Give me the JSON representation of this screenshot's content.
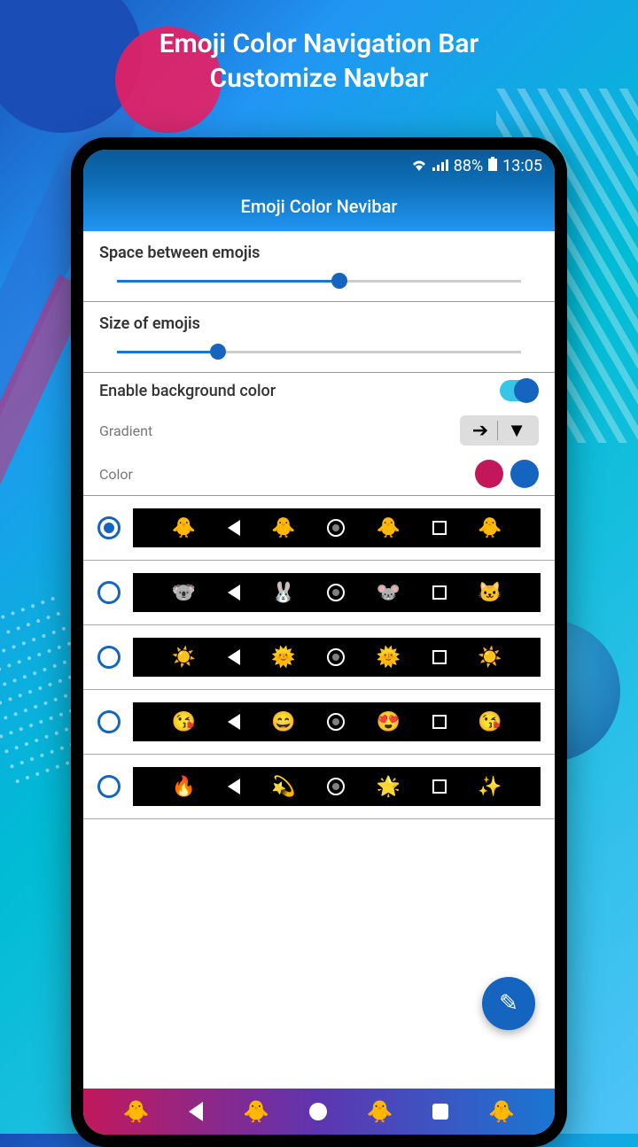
{
  "promo": {
    "line1": "Emoji Color Navigation Bar",
    "line2": "Customize Navbar"
  },
  "statusbar": {
    "battery": "88%",
    "time": "13:05"
  },
  "header": {
    "title": "Emoji Color Nevibar"
  },
  "settings": {
    "space_label": "Space between emojis",
    "space_value": 55,
    "size_label": "Size of emojis",
    "size_value": 25,
    "enable_bg_label": "Enable background color",
    "enable_bg": true,
    "gradient_label": "Gradient",
    "color_label": "Color",
    "colors": {
      "primary": "#c2185b",
      "secondary": "#1565C0"
    }
  },
  "presets": [
    {
      "selected": true,
      "emojis": [
        "🐥",
        "🐥",
        "🐥",
        "🐥"
      ]
    },
    {
      "selected": false,
      "emojis": [
        "🐨",
        "🐰",
        "🐭",
        "🐱"
      ]
    },
    {
      "selected": false,
      "emojis": [
        "☀️",
        "🌞",
        "🌞",
        "☀️"
      ]
    },
    {
      "selected": false,
      "emojis": [
        "😘",
        "😄",
        "😍",
        "😘"
      ]
    },
    {
      "selected": false,
      "emojis": [
        "🔥",
        "💫",
        "🌟",
        "✨"
      ]
    }
  ],
  "bottom_nav_emojis": [
    "🐥",
    "🐥",
    "🐥",
    "🐥"
  ],
  "icons": {
    "edit": "✎",
    "arrow_right": "➔",
    "dropdown": "▼"
  }
}
